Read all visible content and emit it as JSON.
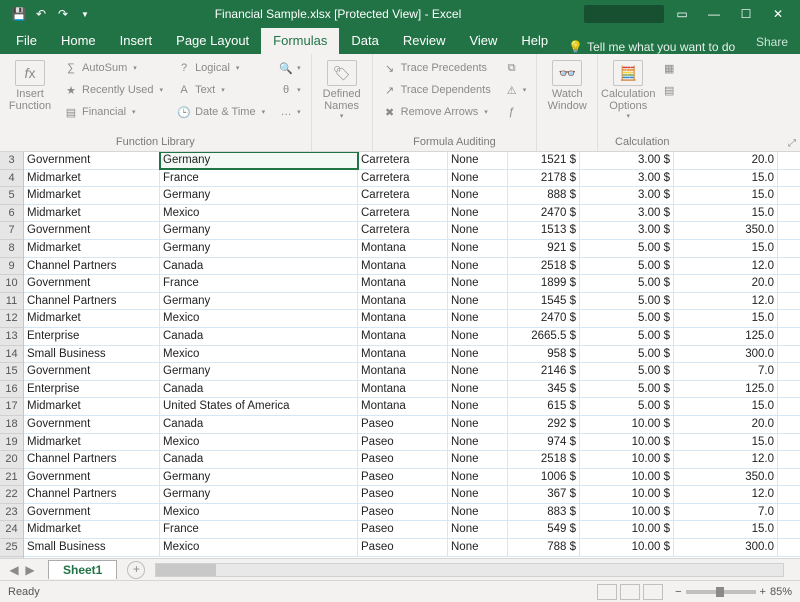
{
  "titlebar": {
    "title": "Financial Sample.xlsx  [Protected View]  -  Excel"
  },
  "tabs": {
    "file": "File",
    "home": "Home",
    "insert": "Insert",
    "pagelayout": "Page Layout",
    "formulas": "Formulas",
    "data": "Data",
    "review": "Review",
    "view": "View",
    "help": "Help",
    "tellme": "Tell me what you want to do",
    "share": "Share"
  },
  "ribbon": {
    "insert_function": "Insert Function",
    "autosum": "AutoSum",
    "recently_used": "Recently Used",
    "financial": "Financial",
    "logical": "Logical",
    "text": "Text",
    "datetime": "Date & Time",
    "function_library": "Function Library",
    "defined_names": "Defined Names",
    "trace_precedents": "Trace Precedents",
    "trace_dependents": "Trace Dependents",
    "remove_arrows": "Remove Arrows",
    "formula_auditing": "Formula Auditing",
    "watch_window": "Watch Window",
    "calc_options": "Calculation Options",
    "calculation": "Calculation"
  },
  "rows": [
    {
      "n": 3,
      "a": "Government",
      "b": "Germany",
      "c": "Carretera",
      "d": "None",
      "e": "1521",
      "f": "$",
      "g": "3.00",
      "h": "$",
      "i": "20.0"
    },
    {
      "n": 4,
      "a": "Midmarket",
      "b": "France",
      "c": "Carretera",
      "d": "None",
      "e": "2178",
      "f": "$",
      "g": "3.00",
      "h": "$",
      "i": "15.0"
    },
    {
      "n": 5,
      "a": "Midmarket",
      "b": "Germany",
      "c": "Carretera",
      "d": "None",
      "e": "888",
      "f": "$",
      "g": "3.00",
      "h": "$",
      "i": "15.0"
    },
    {
      "n": 6,
      "a": "Midmarket",
      "b": "Mexico",
      "c": "Carretera",
      "d": "None",
      "e": "2470",
      "f": "$",
      "g": "3.00",
      "h": "$",
      "i": "15.0"
    },
    {
      "n": 7,
      "a": "Government",
      "b": "Germany",
      "c": "Carretera",
      "d": "None",
      "e": "1513",
      "f": "$",
      "g": "3.00",
      "h": "$",
      "i": "350.0"
    },
    {
      "n": 8,
      "a": "Midmarket",
      "b": "Germany",
      "c": "Montana",
      "d": "None",
      "e": "921",
      "f": "$",
      "g": "5.00",
      "h": "$",
      "i": "15.0"
    },
    {
      "n": 9,
      "a": "Channel Partners",
      "b": "Canada",
      "c": "Montana",
      "d": "None",
      "e": "2518",
      "f": "$",
      "g": "5.00",
      "h": "$",
      "i": "12.0"
    },
    {
      "n": 10,
      "a": "Government",
      "b": "France",
      "c": "Montana",
      "d": "None",
      "e": "1899",
      "f": "$",
      "g": "5.00",
      "h": "$",
      "i": "20.0"
    },
    {
      "n": 11,
      "a": "Channel Partners",
      "b": "Germany",
      "c": "Montana",
      "d": "None",
      "e": "1545",
      "f": "$",
      "g": "5.00",
      "h": "$",
      "i": "12.0"
    },
    {
      "n": 12,
      "a": "Midmarket",
      "b": "Mexico",
      "c": "Montana",
      "d": "None",
      "e": "2470",
      "f": "$",
      "g": "5.00",
      "h": "$",
      "i": "15.0"
    },
    {
      "n": 13,
      "a": "Enterprise",
      "b": "Canada",
      "c": "Montana",
      "d": "None",
      "e": "2665.5",
      "f": "$",
      "g": "5.00",
      "h": "$",
      "i": "125.0"
    },
    {
      "n": 14,
      "a": "Small Business",
      "b": "Mexico",
      "c": "Montana",
      "d": "None",
      "e": "958",
      "f": "$",
      "g": "5.00",
      "h": "$",
      "i": "300.0"
    },
    {
      "n": 15,
      "a": "Government",
      "b": "Germany",
      "c": "Montana",
      "d": "None",
      "e": "2146",
      "f": "$",
      "g": "5.00",
      "h": "$",
      "i": "7.0"
    },
    {
      "n": 16,
      "a": "Enterprise",
      "b": "Canada",
      "c": "Montana",
      "d": "None",
      "e": "345",
      "f": "$",
      "g": "5.00",
      "h": "$",
      "i": "125.0"
    },
    {
      "n": 17,
      "a": "Midmarket",
      "b": "United States of America",
      "c": "Montana",
      "d": "None",
      "e": "615",
      "f": "$",
      "g": "5.00",
      "h": "$",
      "i": "15.0"
    },
    {
      "n": 18,
      "a": "Government",
      "b": "Canada",
      "c": "Paseo",
      "d": "None",
      "e": "292",
      "f": "$",
      "g": "10.00",
      "h": "$",
      "i": "20.0"
    },
    {
      "n": 19,
      "a": "Midmarket",
      "b": "Mexico",
      "c": "Paseo",
      "d": "None",
      "e": "974",
      "f": "$",
      "g": "10.00",
      "h": "$",
      "i": "15.0"
    },
    {
      "n": 20,
      "a": "Channel Partners",
      "b": "Canada",
      "c": "Paseo",
      "d": "None",
      "e": "2518",
      "f": "$",
      "g": "10.00",
      "h": "$",
      "i": "12.0"
    },
    {
      "n": 21,
      "a": "Government",
      "b": "Germany",
      "c": "Paseo",
      "d": "None",
      "e": "1006",
      "f": "$",
      "g": "10.00",
      "h": "$",
      "i": "350.0"
    },
    {
      "n": 22,
      "a": "Channel Partners",
      "b": "Germany",
      "c": "Paseo",
      "d": "None",
      "e": "367",
      "f": "$",
      "g": "10.00",
      "h": "$",
      "i": "12.0"
    },
    {
      "n": 23,
      "a": "Government",
      "b": "Mexico",
      "c": "Paseo",
      "d": "None",
      "e": "883",
      "f": "$",
      "g": "10.00",
      "h": "$",
      "i": "7.0"
    },
    {
      "n": 24,
      "a": "Midmarket",
      "b": "France",
      "c": "Paseo",
      "d": "None",
      "e": "549",
      "f": "$",
      "g": "10.00",
      "h": "$",
      "i": "15.0"
    },
    {
      "n": 25,
      "a": "Small Business",
      "b": "Mexico",
      "c": "Paseo",
      "d": "None",
      "e": "788",
      "f": "$",
      "g": "10.00",
      "h": "$",
      "i": "300.0"
    }
  ],
  "sheets": {
    "sheet1": "Sheet1"
  },
  "status": {
    "ready": "Ready",
    "zoom": "85%"
  }
}
